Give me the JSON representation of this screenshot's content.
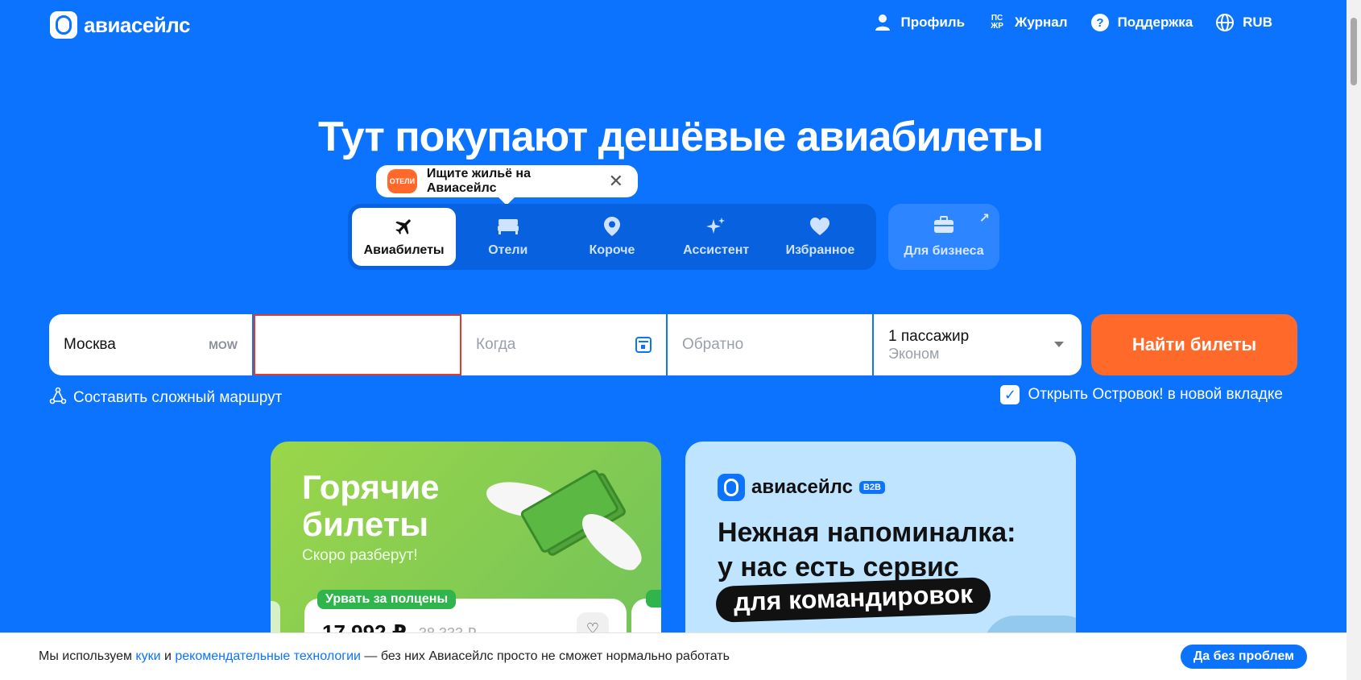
{
  "header": {
    "logo_text": "авиасейлс",
    "nav": {
      "profile": "Профиль",
      "journal_icon": "ПС ЖР",
      "journal": "Журнал",
      "support": "Поддержка",
      "currency": "RUB"
    }
  },
  "hero": {
    "title": "Тут покупают дешёвые авиабилеты"
  },
  "tooltip": {
    "badge": "ОТЕЛИ",
    "text": "Ищите жильё на Авиасейлс",
    "close": "✕"
  },
  "tabs": [
    {
      "label": "Авиабилеты",
      "icon": "plane-icon"
    },
    {
      "label": "Отели",
      "icon": "bed-icon"
    },
    {
      "label": "Короче",
      "icon": "location-pin-icon"
    },
    {
      "label": "Ассистент",
      "icon": "sparkles-icon"
    },
    {
      "label": "Избранное",
      "icon": "heart-icon"
    }
  ],
  "business": {
    "label": "Для бизнеса",
    "arrow": "↗"
  },
  "search": {
    "origin": "Москва",
    "origin_code": "MOW",
    "destination": "",
    "when_placeholder": "Когда",
    "back_placeholder": "Обратно",
    "passengers": "1 пассажир",
    "class": "Эконом",
    "submit": "Найти билеты"
  },
  "complex_route": "Составить сложный маршрут",
  "open_new_tab": {
    "label": "Открыть Островок! в новой вкладке",
    "checked": true
  },
  "card_hot": {
    "title_line1": "Горячие",
    "title_line2": "билеты",
    "subtitle": "Скоро разберут!",
    "tag": "Урвать за полцены",
    "price": "17 992 ₽",
    "old_price": "38 333 ₽"
  },
  "card_b2b": {
    "logo_text": "авиасейлс",
    "logo_badge": "B2B",
    "line1": "Нежная напоминалка:",
    "line2": "у нас есть сервис",
    "pill": "для командировок"
  },
  "cookie": {
    "text_before": "Мы используем ",
    "link1": "куки",
    "text_mid": " и ",
    "link2": "рекомендательные технологии",
    "text_after": " — без них Авиасейлс просто не сможет нормально работать",
    "button": "Да без проблем"
  },
  "colors": {
    "brand_blue": "#0c73fe",
    "accent_orange": "#ff6a2b",
    "green": "#2fb54b"
  }
}
